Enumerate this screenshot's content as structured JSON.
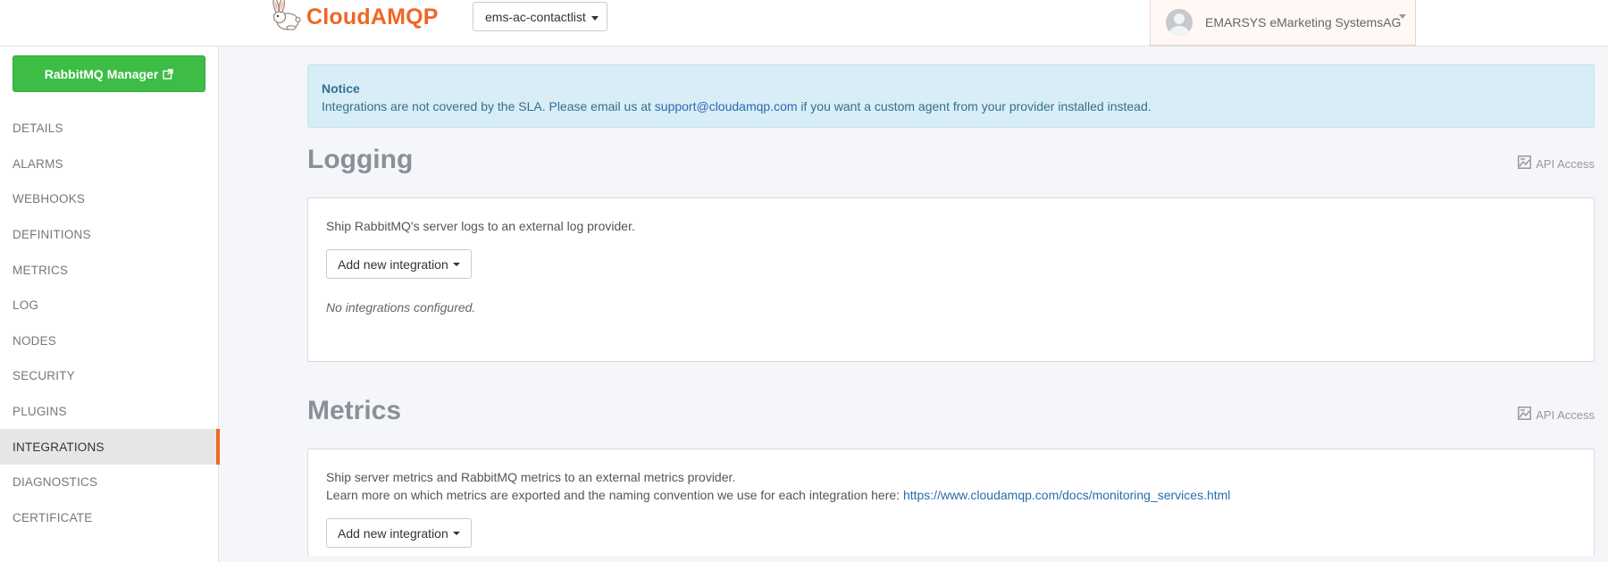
{
  "brand": {
    "name": "CloudAMQP",
    "accent_color": "#f16624",
    "logo_icon": "rabbit-logo-icon"
  },
  "header": {
    "instance_select": {
      "value": "ems-ac-contactlist"
    },
    "user": {
      "name": "EMARSYS eMarketing SystemsAG",
      "avatar_icon": "user-avatar-icon"
    }
  },
  "sidebar": {
    "manager_button": {
      "label": "RabbitMQ Manager",
      "icon": "external-link-icon",
      "color": "#3dbd45"
    },
    "items": [
      {
        "label": "DETAILS"
      },
      {
        "label": "ALARMS"
      },
      {
        "label": "WEBHOOKS"
      },
      {
        "label": "DEFINITIONS"
      },
      {
        "label": "METRICS"
      },
      {
        "label": "LOG"
      },
      {
        "label": "NODES"
      },
      {
        "label": "SECURITY"
      },
      {
        "label": "PLUGINS"
      },
      {
        "label": "INTEGRATIONS",
        "active": true
      },
      {
        "label": "DIAGNOSTICS"
      },
      {
        "label": "CERTIFICATE"
      }
    ]
  },
  "notice": {
    "title": "Notice",
    "text_before": "Integrations are not covered by the SLA. Please email us at ",
    "email": "support@cloudamqp.com",
    "text_after": " if you want a custom agent from your provider installed instead."
  },
  "logging": {
    "title": "Logging",
    "api_access": "API Access",
    "description": "Ship RabbitMQ's server logs to an external log provider.",
    "add_button": "Add new integration",
    "empty_text": "No integrations configured."
  },
  "metrics": {
    "title": "Metrics",
    "api_access": "API Access",
    "description_1": "Ship server metrics and RabbitMQ metrics to an external metrics provider.",
    "description_2": "Learn more on which metrics are exported and the naming convention we use for each integration here: ",
    "docs_link": "https://www.cloudamqp.com/docs/monitoring_services.html",
    "add_button": "Add new integration"
  }
}
